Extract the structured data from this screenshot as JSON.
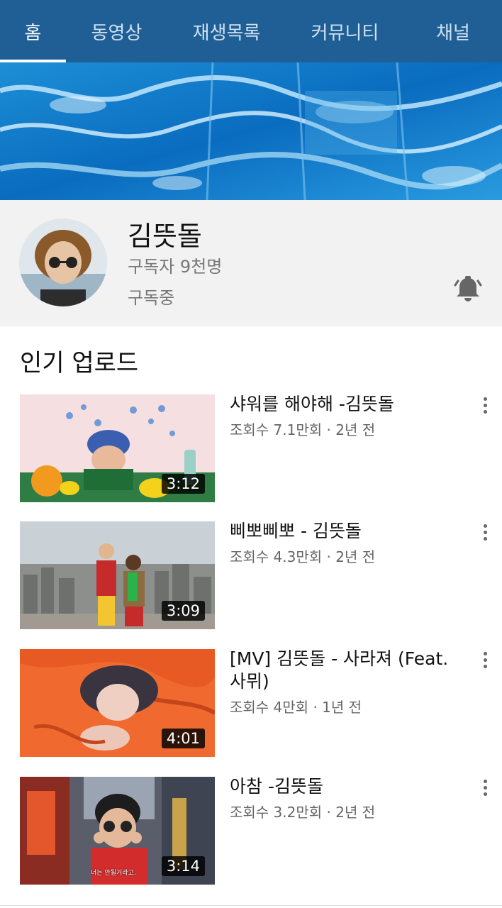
{
  "tabs": [
    {
      "label": "홈",
      "active": true
    },
    {
      "label": "동영상",
      "active": false
    },
    {
      "label": "재생목록",
      "active": false
    },
    {
      "label": "커뮤니티",
      "active": false
    },
    {
      "label": "채널",
      "active": false
    }
  ],
  "channel": {
    "name": "김뜻돌",
    "subscribers": "구독자 9천명",
    "status": "구독중",
    "bell_icon": "bell-icon"
  },
  "section": {
    "title": "인기 업로드"
  },
  "videos": [
    {
      "title": "샤워를 해야해 -김뜻돌",
      "meta": "조회수 7.1만회 · 2년 전",
      "duration": "3:12"
    },
    {
      "title": "삐뽀삐뽀 - 김뜻돌",
      "meta": "조회수 4.3만회 · 2년 전",
      "duration": "3:09"
    },
    {
      "title": "[MV] 김뜻돌 - 사라져 (Feat.사뮈)",
      "meta": "조회수 4만회 · 1년 전",
      "duration": "4:01"
    },
    {
      "title": "아참 -김뜻돌",
      "meta": "조회수 3.2만회 · 2년 전",
      "duration": "3:14"
    }
  ],
  "thumbnail_text": {
    "video_4_subtitle": "너는 안될거라고."
  },
  "colors": {
    "header": "#1f5f96",
    "channel_bg": "#f2f2f2"
  }
}
